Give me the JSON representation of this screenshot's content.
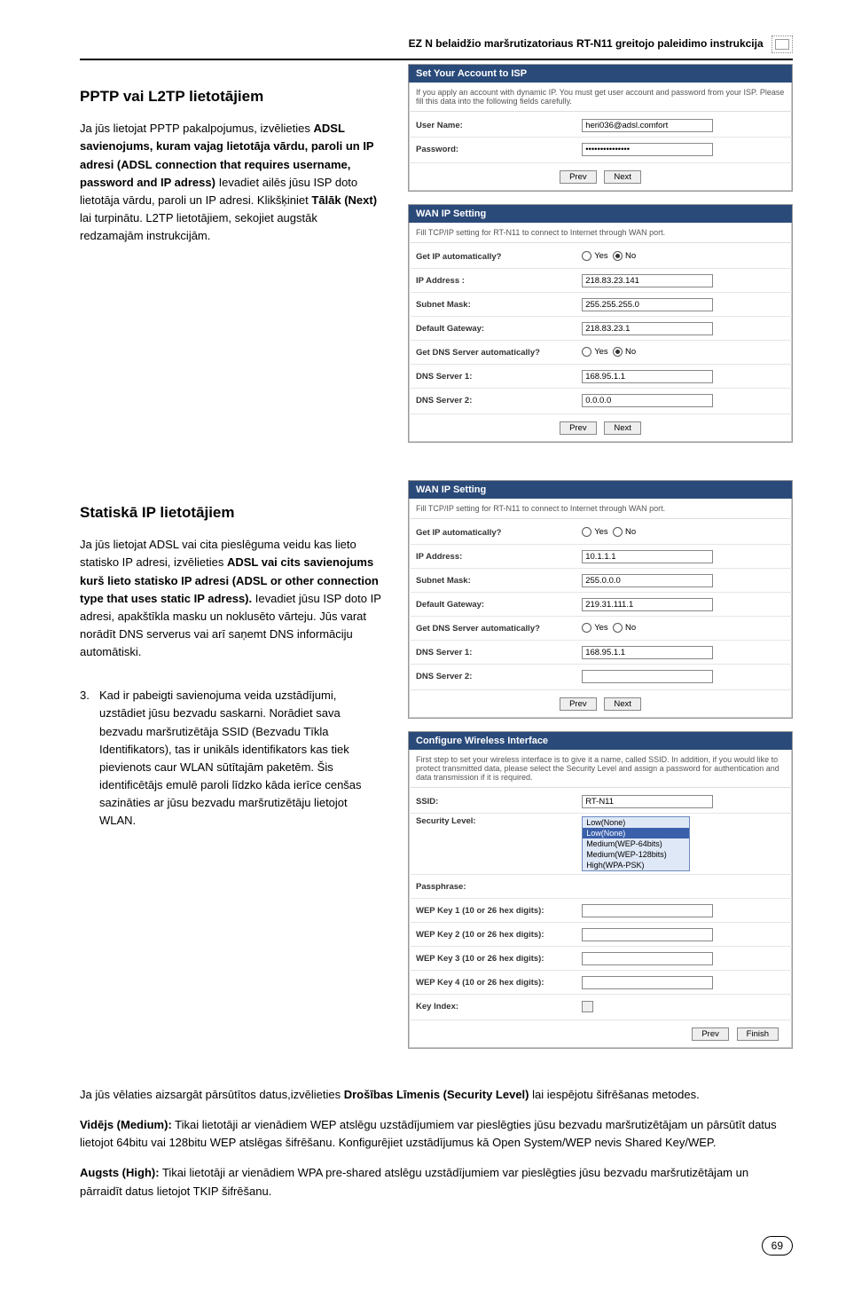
{
  "header": {
    "title": "EZ N belaidžio maršrutizatoriaus RT-N11 greitojo paleidimo instrukcija"
  },
  "section1": {
    "heading": "PPTP vai L2TP lietotājiem",
    "para_pre": "Ja jūs lietojat PPTP pakalpojumus, izvēlieties ",
    "bold1": "ADSL savienojums, kuram vajag lietotāja vārdu, paroli un IP adresi (ADSL connection that requires username, password and IP adress)",
    "para_post1": " Ievadiet ailēs jūsu ISP doto lietotāja vārdu, paroli un IP adresi. Klikšķiniet ",
    "bold2": "Tālāk (Next)",
    "para_post2": " lai turpinātu. L2TP lietotājiem, sekojiet augstāk redzamajām instrukcijām."
  },
  "panel_account": {
    "title": "Set Your Account to ISP",
    "desc": "If you apply an account with dynamic IP. You must get user account and password from your ISP. Please fill this data into the following fields carefully.",
    "user_label": "User Name:",
    "user_value": "heri036@adsl.comfort",
    "pass_label": "Password:",
    "pass_value": "•••••••••••••••",
    "prev": "Prev",
    "next": "Next"
  },
  "panel_wan1": {
    "title": "WAN IP Setting",
    "desc": "Fill TCP/IP setting for RT-N11 to connect to Internet through WAN port.",
    "rows": {
      "getip_label": "Get IP automatically?",
      "getip_yes": "Yes",
      "getip_no": "No",
      "ip_label": "IP Address :",
      "ip_value": "218.83.23.141",
      "mask_label": "Subnet Mask:",
      "mask_value": "255.255.255.0",
      "gw_label": "Default Gateway:",
      "gw_value": "218.83.23.1",
      "getdns_label": "Get DNS Server automatically?",
      "dns1_label": "DNS Server 1:",
      "dns1_value": "168.95.1.1",
      "dns2_label": "DNS Server 2:",
      "dns2_value": "0.0.0.0"
    },
    "prev": "Prev",
    "next": "Next"
  },
  "section2": {
    "heading": "Statiskā IP lietotājiem",
    "para_pre": "Ja jūs lietojat ADSL vai cita pieslēguma veidu kas lieto statisko IP adresi, izvēlieties ",
    "bold1": "ADSL vai cits savienojums kurš lieto statisko IP adresi (ADSL or other connection type that uses static IP adress).",
    "para_post": " Ievadiet jūsu ISP doto IP adresi, apakštīkla masku un noklusēto vārteju. Jūs varat norādīt DNS serverus vai arī saņemt DNS informāciju automātiski."
  },
  "panel_wan2": {
    "title": "WAN IP Setting",
    "desc": "Fill TCP/IP setting for RT-N11 to connect to Internet through WAN port.",
    "rows": {
      "getip_label": "Get IP automatically?",
      "ip_label": "IP Address:",
      "ip_value": "10.1.1.1",
      "mask_label": "Subnet Mask:",
      "mask_value": "255.0.0.0",
      "gw_label": "Default Gateway:",
      "gw_value": "219.31.111.1",
      "getdns_label": "Get DNS Server automatically?",
      "dns1_label": "DNS Server 1:",
      "dns1_value": "168.95.1.1",
      "dns2_label": "DNS Server 2:",
      "dns2_value": ""
    },
    "yes": "Yes",
    "no": "No",
    "prev": "Prev",
    "next": "Next"
  },
  "step3": {
    "num": "3.",
    "text": "Kad ir pabeigti savienojuma veida uzstādījumi, uzstādiet jūsu bezvadu saskarni. Norādiet sava bezvadu maršrutizētāja SSID (Bezvadu Tīkla Identifikators), tas ir unikāls identifikators kas tiek pievienots caur WLAN sūtītajām paketēm. Šis identificētājs emulē paroli līdzko kāda ierīce cenšas sazināties ar jūsu bezvadu maršrutizētāju lietojot WLAN."
  },
  "panel_wireless": {
    "title": "Configure Wireless Interface",
    "desc": "First step to set your wireless interface is to give it a name, called SSID. In addition, if you would like to protect transmitted data, please select the Security Level and assign a password for authentication and data transmission if it is required.",
    "ssid_label": "SSID:",
    "ssid_value": "RT-N11",
    "seclevel_label": "Security Level:",
    "sec_opts": {
      "o1": "Low(None)",
      "o2": "Low(None)",
      "o3": "Medium(WEP-64bits)",
      "o4": "Medium(WEP-128bits)",
      "o5": "High(WPA-PSK)"
    },
    "pass_label": "Passphrase:",
    "wep1": "WEP Key 1 (10 or 26 hex digits):",
    "wep2": "WEP Key 2 (10 or 26 hex digits):",
    "wep3": "WEP Key 3 (10 or 26 hex digits):",
    "wep4": "WEP Key 4 (10 or 26 hex digits):",
    "keyidx": "Key Index:",
    "prev": "Prev",
    "finish": "Finish"
  },
  "bottom": {
    "p1a": "Ja jūs vēlaties aizsargāt pārsūtītos datus,izvēlieties ",
    "p1b": "Drošības Līmenis (Security Level)",
    "p1c": " lai iespējotu šifrēšanas metodes.",
    "p2a": "Vidējs (Medium):",
    "p2b": " Tikai lietotāji ar vienādiem WEP atslēgu uzstādījumiem var pieslēgties jūsu bezvadu maršrutizētājam un pārsūtīt datus lietojot 64bitu vai 128bitu WEP atslēgas šifrēšanu. Konfigurējiet uzstādījumus kā Open System/WEP nevis Shared Key/WEP.",
    "p3a": "Augsts (High):",
    "p3b": " Tikai lietotāji ar vienādiem WPA pre-shared atslēgu uzstādījumiem var pieslēgties jūsu bezvadu maršrutizētājam un pārraidīt datus lietojot TKIP šifrēšanu."
  },
  "pagenum": "69"
}
